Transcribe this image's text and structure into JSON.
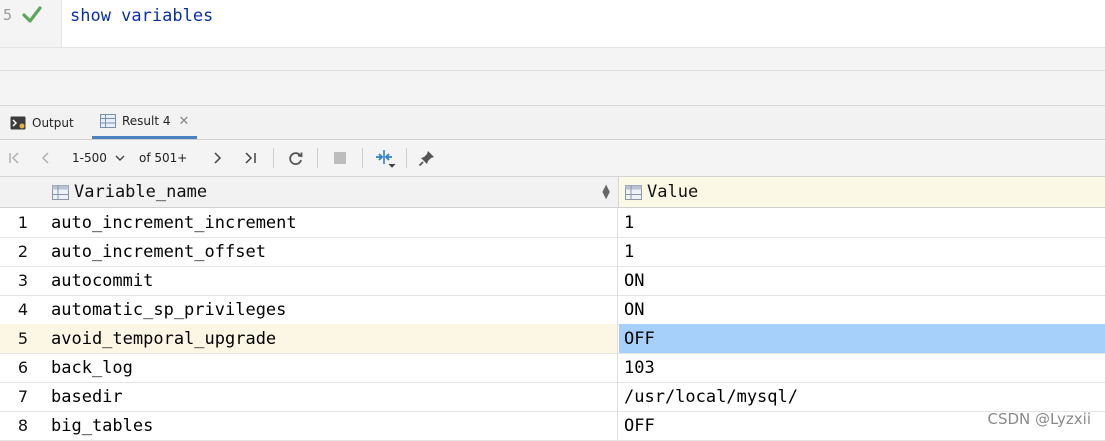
{
  "editor": {
    "line_number": "5",
    "code": "show variables"
  },
  "tabs": [
    {
      "label": "Output"
    },
    {
      "label": "Result 4"
    }
  ],
  "toolbar": {
    "range": "1-500",
    "of_total": "of 501+"
  },
  "grid": {
    "columns": [
      "Variable_name",
      "Value"
    ],
    "rows": [
      {
        "n": "1",
        "name": "auto_increment_increment",
        "value": "1"
      },
      {
        "n": "2",
        "name": "auto_increment_offset",
        "value": "1"
      },
      {
        "n": "3",
        "name": "autocommit",
        "value": "ON"
      },
      {
        "n": "4",
        "name": "automatic_sp_privileges",
        "value": "ON"
      },
      {
        "n": "5",
        "name": "avoid_temporal_upgrade",
        "value": "OFF"
      },
      {
        "n": "6",
        "name": "back_log",
        "value": "103"
      },
      {
        "n": "7",
        "name": "basedir",
        "value": "/usr/local/mysql/"
      },
      {
        "n": "8",
        "name": "big_tables",
        "value": "OFF"
      }
    ],
    "selected_row": 5
  },
  "watermark": "CSDN @Lyzxii",
  "colors": {
    "keyword": "#0b2fa8",
    "check": "#5aa65a",
    "selected_cell": "#a6d0fa",
    "selected_row": "#fcf7e4"
  }
}
